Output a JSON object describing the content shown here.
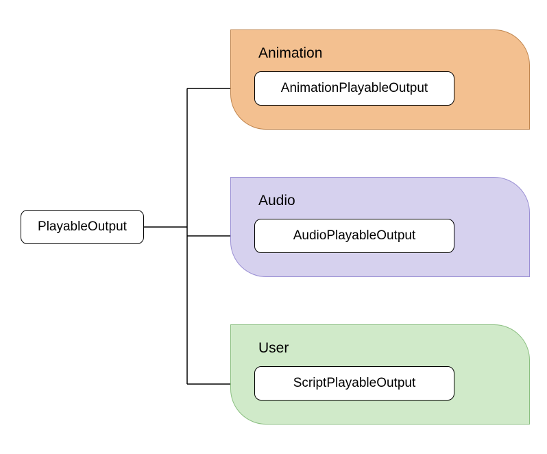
{
  "root": {
    "label": "PlayableOutput"
  },
  "groups": [
    {
      "key": "animation",
      "title": "Animation",
      "child_label": "AnimationPlayableOutput",
      "fill": "#f3c090",
      "stroke": "#c0864f"
    },
    {
      "key": "audio",
      "title": "Audio",
      "child_label": "AudioPlayableOutput",
      "fill": "#d6d1ee",
      "stroke": "#9a8fd4"
    },
    {
      "key": "user",
      "title": "User",
      "child_label": "ScriptPlayableOutput",
      "fill": "#d0eac9",
      "stroke": "#8bbf81"
    }
  ]
}
